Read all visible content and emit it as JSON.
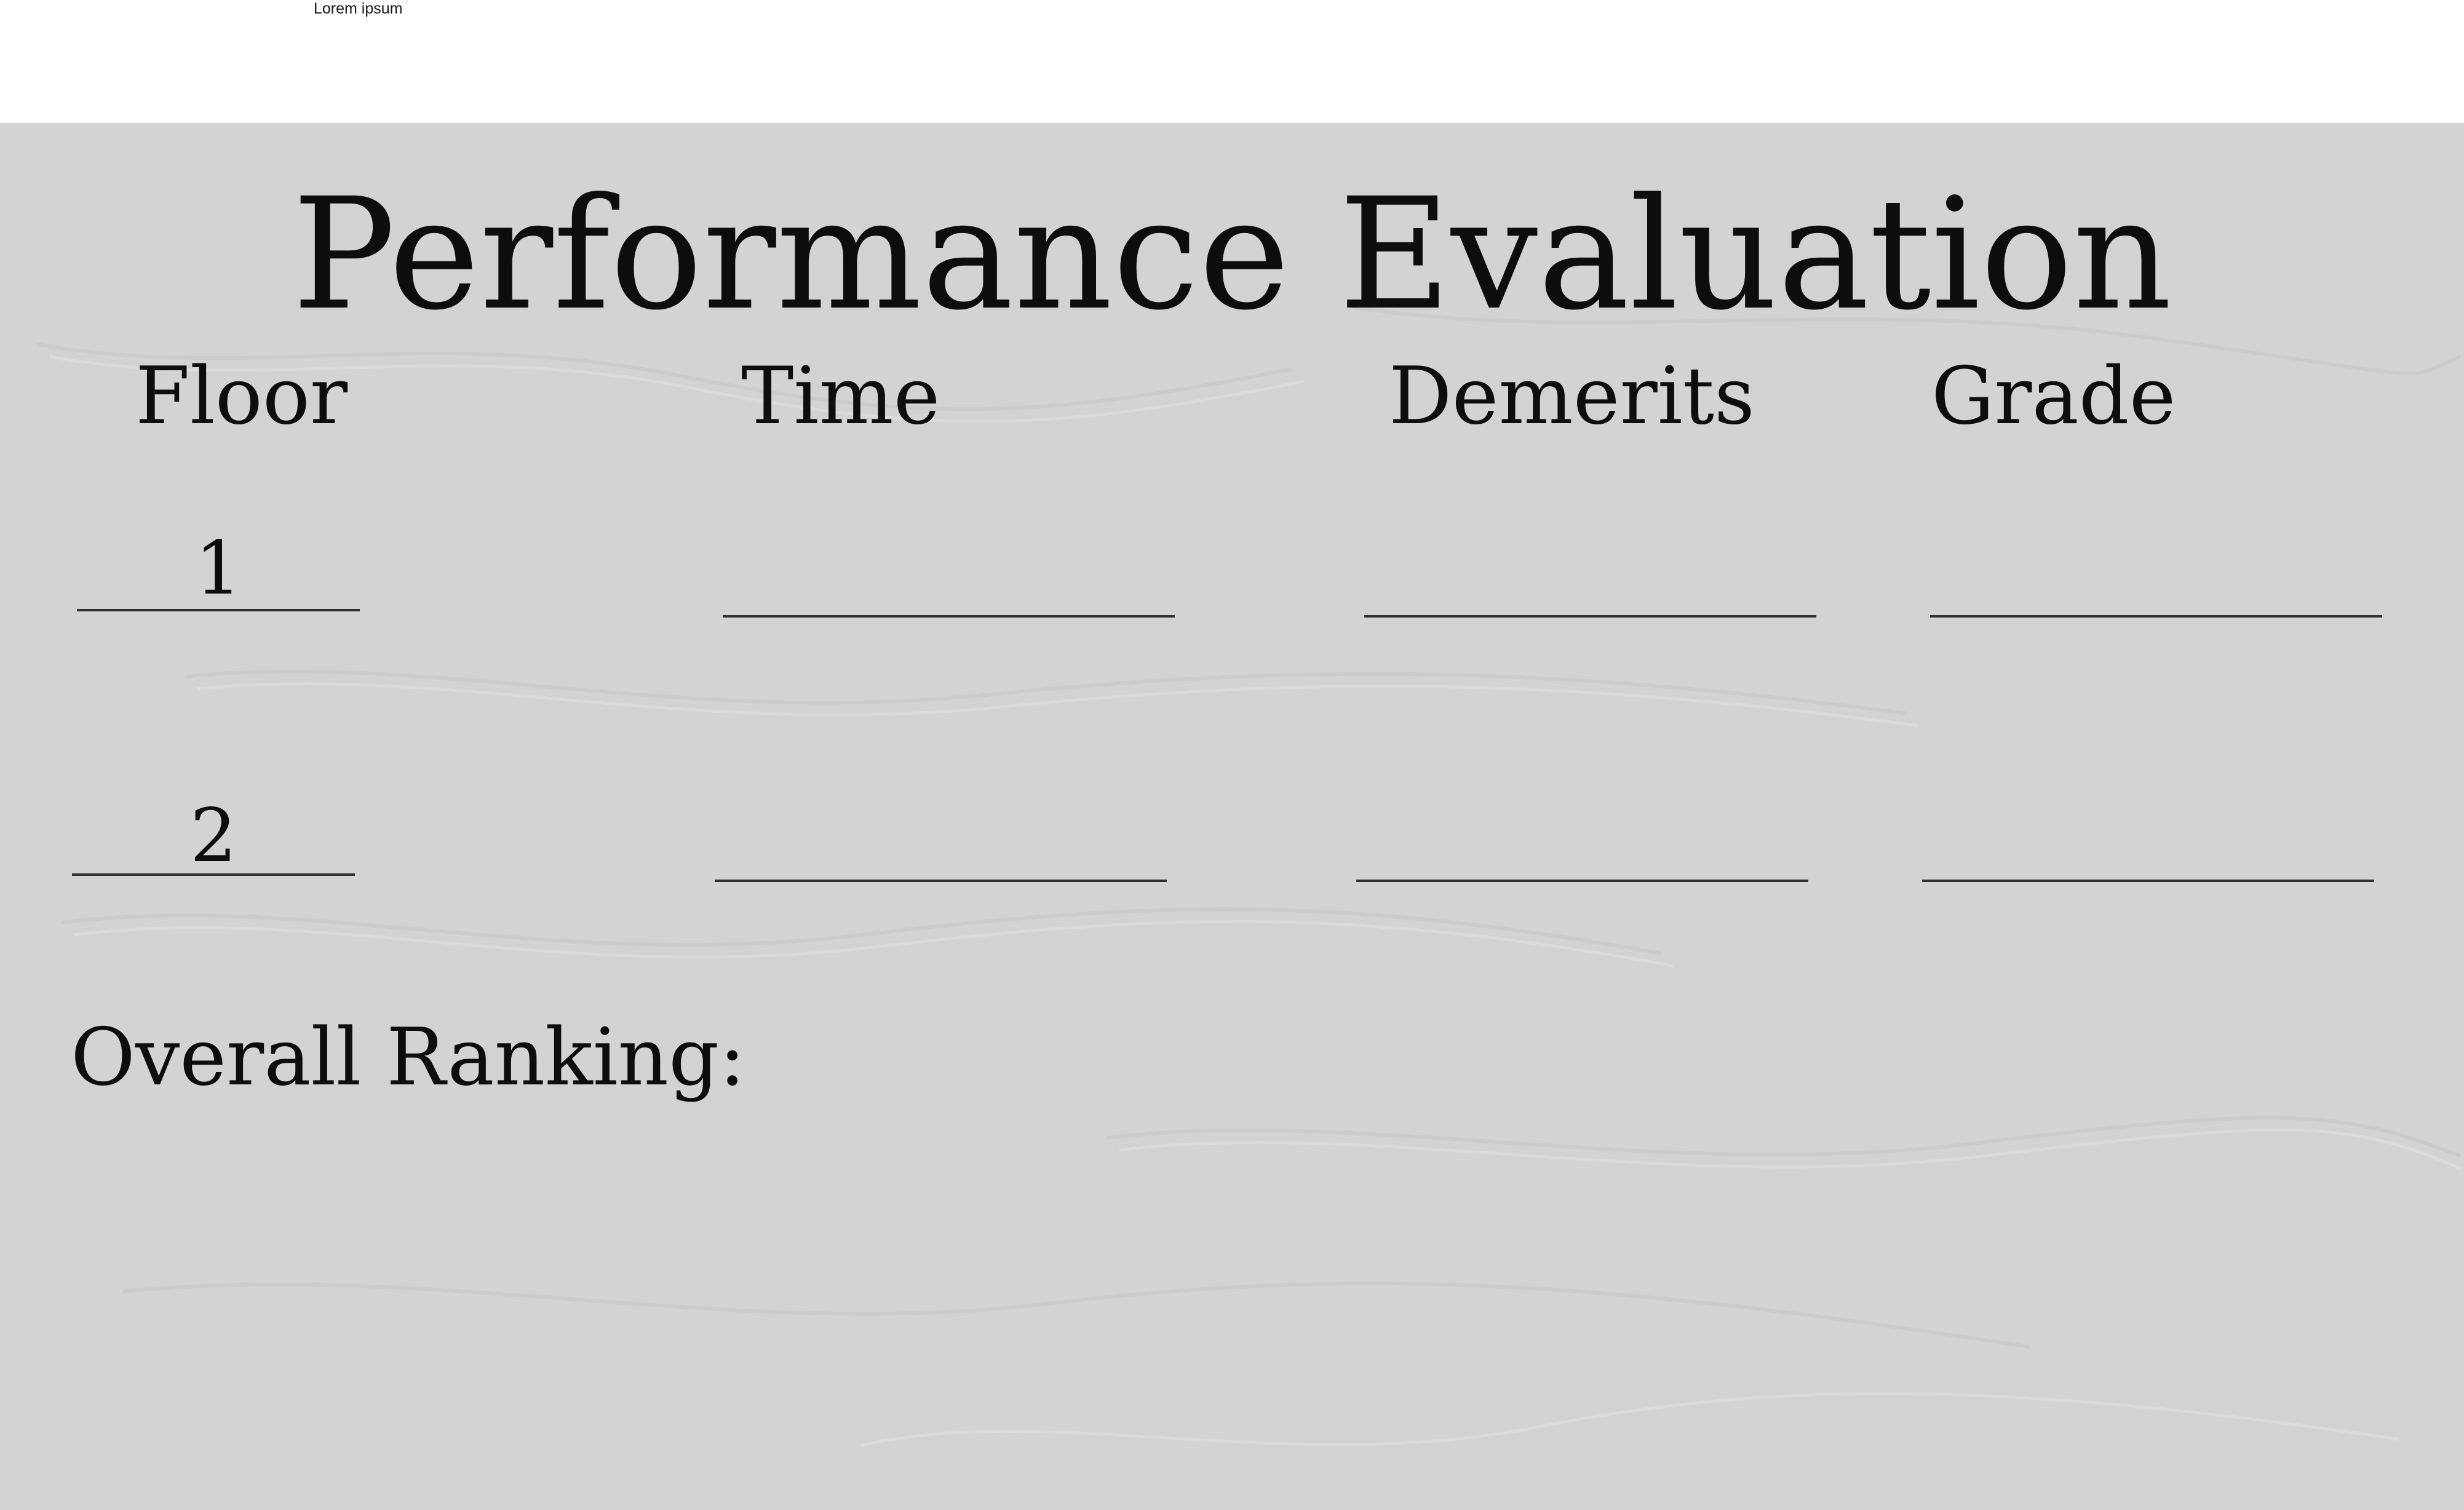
{
  "corner_label": "Lorem ipsum",
  "sheet": {
    "background_color": "#d3d3d3",
    "title": "Performance Evaluation",
    "columns": {
      "floor": "Floor",
      "time": "Time",
      "demerits": "Demerits",
      "grade": "Grade"
    },
    "rows": [
      {
        "floor": "1"
      },
      {
        "floor": "2"
      }
    ],
    "overall_ranking_label": "Overall Ranking:"
  }
}
